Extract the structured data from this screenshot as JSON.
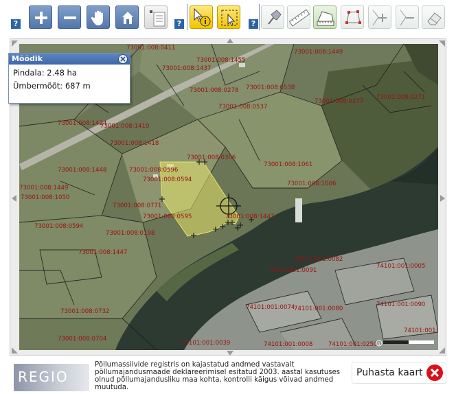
{
  "toolbar": {
    "help": "?",
    "tools": [
      {
        "name": "zoom-in",
        "icon": "plus-icon"
      },
      {
        "name": "zoom-out",
        "icon": "minus-icon"
      },
      {
        "name": "pan",
        "icon": "hand-icon"
      },
      {
        "name": "home",
        "icon": "house-icon"
      },
      {
        "name": "layers",
        "icon": "layers-icon"
      },
      {
        "name": "identify",
        "icon": "info-cursor-icon"
      },
      {
        "name": "select",
        "icon": "select-cursor-icon"
      },
      {
        "name": "pin",
        "icon": "pushpin-icon"
      },
      {
        "name": "measure-distance",
        "icon": "ruler-icon"
      },
      {
        "name": "measure-area",
        "icon": "area-icon"
      },
      {
        "name": "draw-polygon",
        "icon": "polygon-icon"
      },
      {
        "name": "add-vertex",
        "icon": "add-vertex-icon"
      },
      {
        "name": "remove-vertex",
        "icon": "remove-vertex-icon"
      },
      {
        "name": "erase",
        "icon": "eraser-icon"
      }
    ]
  },
  "measure": {
    "title": "Mõõdik",
    "area_label": "Pindala: 2.48 ha",
    "perimeter_label": "Ümbermõõt: 687 m"
  },
  "map": {
    "parcel_labels": [
      "73001:008:0411",
      "73001:008:1455",
      "73001:008:1449",
      "73001:008:1437",
      "73001:008:0278",
      "73001:008:0538",
      "73001:008:0537",
      "73001:008:0277",
      "73001:008:0271",
      "73001:008:1424",
      "73001:008:1419",
      "73001:008:1418",
      "73001:008:0306",
      "73001:008:1448",
      "73001:008:0596",
      "73001:008:0594",
      "73001:008:1061",
      "73001:008:1006",
      "73001:008:1449",
      "73001:008:1050",
      "73001:008:0771",
      "73001:008:0595",
      "73001:008:1447",
      "73001:008:0594",
      "73001:008:0198",
      "73001:008:1447",
      "74101:001:0082",
      "74101:001:0005",
      "74101:001:0091",
      "74101:001:0074",
      "74101:001:0090",
      "74101:001:0080",
      "73001:008:0732",
      "74101:001:0008",
      "73001:008:0704",
      "74101:001:0039",
      "74101:001:0250",
      "74101:001:0078"
    ],
    "scale_label": "0"
  },
  "footer": {
    "logo_text": "REGIO",
    "note": "Põllumassiivide registris on kajastatud andmed vastavalt põllumajandusmaade deklareerimisel esitatud 2003. aastal kasutuses olnud põllumajandusliku maa kohta, kontrolli käigus võivad andmed muutuda.",
    "clear_label": "Puhasta kaart"
  },
  "colors": {
    "toolbar_blue": "#5377aa",
    "active_yellow": "#f2c400",
    "active_green": "#c7e1b8",
    "label_red": "#9a1111",
    "selection_yellow": "#e6e36a",
    "clear_red": "#d7121a"
  }
}
